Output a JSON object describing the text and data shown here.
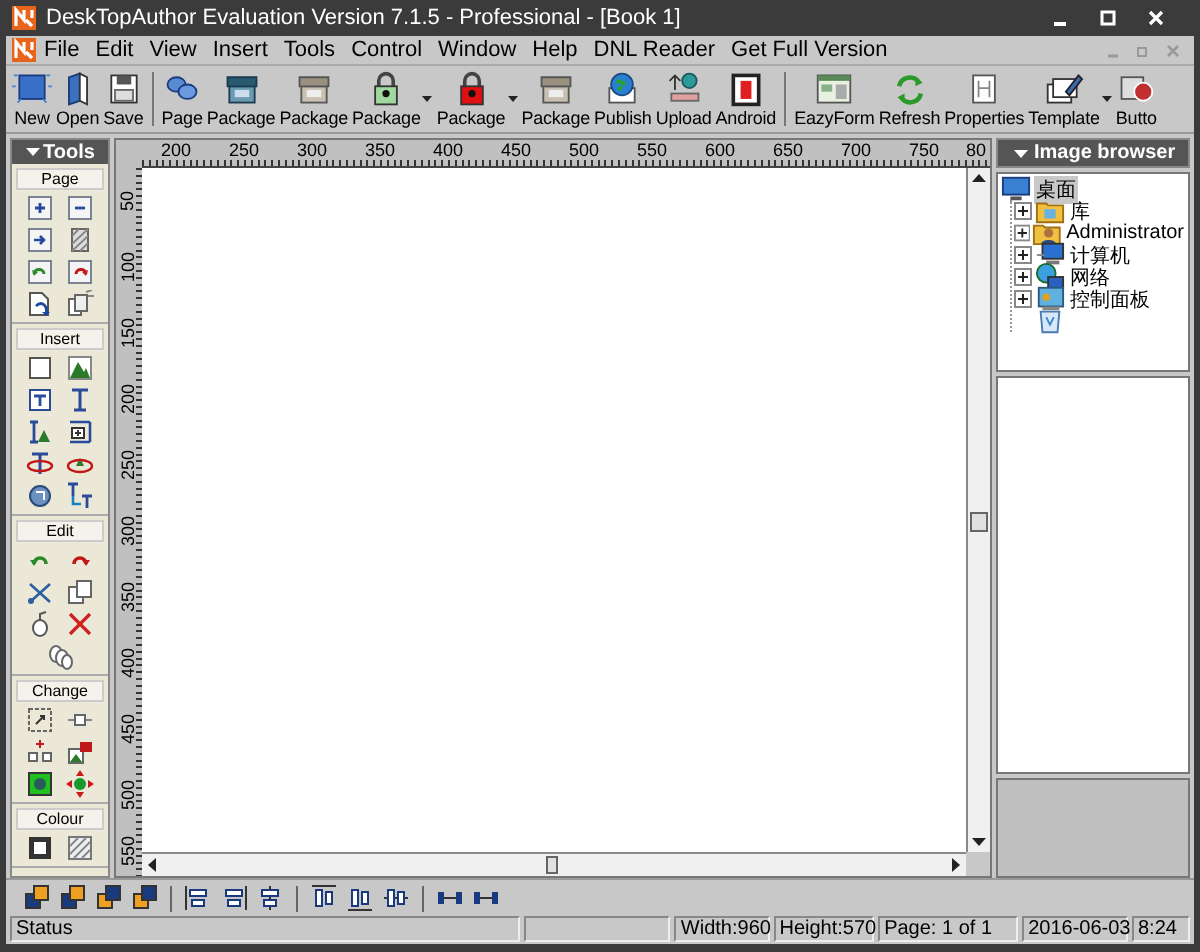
{
  "window": {
    "title": "DeskTopAuthor Evaluation Version 7.1.5 - Professional - [Book 1]"
  },
  "menu": [
    "File",
    "Edit",
    "View",
    "Insert",
    "Tools",
    "Control",
    "Window",
    "Help",
    "DNL Reader",
    "Get Full Version"
  ],
  "toolbar": {
    "groups": [
      {
        "buttons": [
          {
            "label": "New",
            "dropdown": false
          },
          {
            "label": "Open",
            "dropdown": false
          },
          {
            "label": "Save",
            "dropdown": false
          }
        ]
      },
      {
        "buttons": [
          {
            "label": "Page",
            "dropdown": false
          },
          {
            "label": "Package",
            "dropdown": false
          },
          {
            "label": "Package",
            "dropdown": false
          },
          {
            "label": "Package",
            "dropdown": true
          },
          {
            "label": "Package",
            "dropdown": true
          },
          {
            "label": "Package",
            "dropdown": false
          },
          {
            "label": "Publish",
            "dropdown": false
          },
          {
            "label": "Upload",
            "dropdown": false
          },
          {
            "label": "Android",
            "dropdown": false
          }
        ]
      },
      {
        "buttons": [
          {
            "label": "EazyForm",
            "dropdown": false
          },
          {
            "label": "Refresh",
            "dropdown": false
          },
          {
            "label": "Properties",
            "dropdown": false
          },
          {
            "label": "Template",
            "dropdown": true
          },
          {
            "label": "Butto",
            "dropdown": false
          }
        ]
      }
    ]
  },
  "tools_panel": {
    "title": "Tools",
    "sections": [
      {
        "label": "Page"
      },
      {
        "label": "Insert"
      },
      {
        "label": "Edit"
      },
      {
        "label": "Change"
      },
      {
        "label": "Colour"
      }
    ]
  },
  "ruler": {
    "horizontal": [
      "200",
      "250",
      "300",
      "350",
      "400",
      "450",
      "500",
      "550",
      "600",
      "650",
      "700",
      "750",
      "80"
    ],
    "vertical": [
      "50",
      "100",
      "150",
      "200",
      "250",
      "300",
      "350",
      "400",
      "450",
      "500",
      "550"
    ]
  },
  "image_browser": {
    "title": "Image browser",
    "tree": [
      {
        "label": "桌面",
        "selected": true,
        "children": [
          {
            "label": "库",
            "selected": false,
            "expanded": false
          },
          {
            "label": "Administrator",
            "selected": false,
            "expanded": false
          },
          {
            "label": "计算机",
            "selected": false,
            "expanded": false
          },
          {
            "label": "网络",
            "selected": false,
            "expanded": false
          },
          {
            "label": "控制面板",
            "selected": false,
            "expanded": false
          },
          {
            "selected": false
          }
        ]
      }
    ]
  },
  "status_bar": {
    "message": "Status",
    "fields": [
      "Width:960",
      "Height:570",
      "Page: 1 of 1",
      "2016-06-03",
      "8:24"
    ]
  }
}
